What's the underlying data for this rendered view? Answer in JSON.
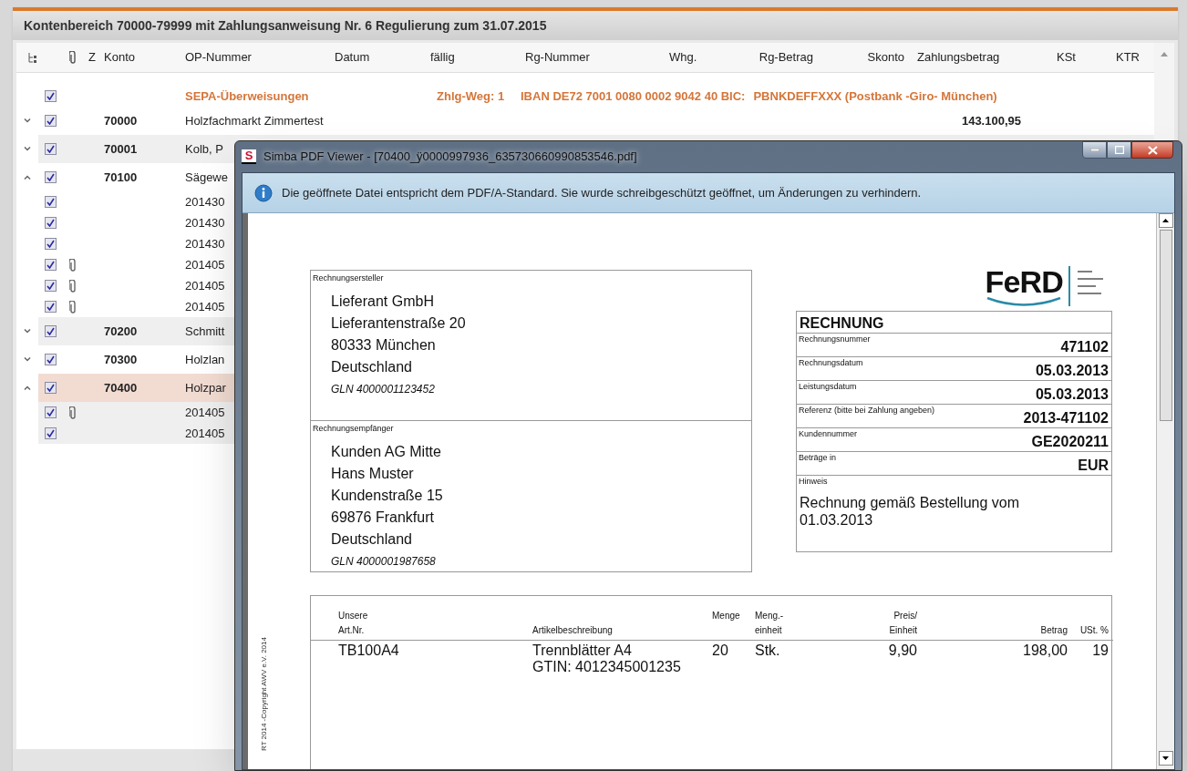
{
  "main_window": {
    "title": "Kontenbereich 70000-79999 mit Zahlungsanweisung Nr. 6 Regulierung zum 31.07.2015",
    "columns": [
      "Z",
      "Konto",
      "OP-Nummer",
      "Datum",
      "fällig",
      "Rg-Nummer",
      "Whg.",
      "Rg-Betrag",
      "Skonto",
      "Zahlungsbetrag",
      "KSt",
      "KTR"
    ],
    "rows": [
      {
        "kind": "payment_method",
        "checked": true,
        "name": "SEPA-Überweisungen",
        "route": "Zhlg-Weg: 1",
        "iban": "IBAN DE72 7001 0080 0002 9042 40 BIC:",
        "bic": "PBNKDEFFXXX (Postbank -Giro- München)"
      },
      {
        "kind": "account",
        "expanded": false,
        "checked": true,
        "selected": false,
        "shaded": false,
        "account": "70000",
        "name": "Holzfachmarkt Zimmertest",
        "amount": "143.100,95"
      },
      {
        "kind": "account",
        "expanded": false,
        "checked": true,
        "selected": false,
        "shaded": true,
        "account": "70001",
        "name": "Kolb, P"
      },
      {
        "kind": "account",
        "expanded": true,
        "checked": true,
        "selected": false,
        "shaded": false,
        "account": "70100",
        "name": "Sägewe"
      },
      {
        "kind": "item",
        "checked": true,
        "attachment": false,
        "shaded": false,
        "op_number": "201430"
      },
      {
        "kind": "item",
        "checked": true,
        "attachment": false,
        "shaded": false,
        "op_number": "201430"
      },
      {
        "kind": "item",
        "checked": true,
        "attachment": false,
        "shaded": false,
        "op_number": "201430"
      },
      {
        "kind": "item",
        "checked": true,
        "attachment": true,
        "shaded": false,
        "op_number": "201405"
      },
      {
        "kind": "item",
        "checked": true,
        "attachment": true,
        "shaded": false,
        "op_number": "201405"
      },
      {
        "kind": "item",
        "checked": true,
        "attachment": true,
        "shaded": false,
        "op_number": "201405"
      },
      {
        "kind": "account",
        "expanded": false,
        "checked": true,
        "selected": false,
        "shaded": true,
        "account": "70200",
        "name": "Schmitt"
      },
      {
        "kind": "account",
        "expanded": false,
        "checked": true,
        "selected": false,
        "shaded": false,
        "account": "70300",
        "name": "Holzlan"
      },
      {
        "kind": "account",
        "expanded": true,
        "checked": true,
        "selected": true,
        "account": "70400",
        "name": "Holzpar"
      },
      {
        "kind": "item",
        "checked": true,
        "attachment": true,
        "shaded": true,
        "op_number": "201405"
      },
      {
        "kind": "item",
        "checked": true,
        "attachment": false,
        "shaded": true,
        "op_number": "201405"
      }
    ]
  },
  "pdf_viewer": {
    "title": "Simba PDF Viewer - [70400_ÿ0000997936_635730660990853546.pdf]",
    "app_logo": "S",
    "info": "Die geöffnete Datei entspricht dem PDF/A-Standard. Sie wurde schreibgeschützt geöffnet, um Änderungen zu verhindern.",
    "document": {
      "sender": {
        "label": "Rechnungsersteller",
        "lines": [
          "Lieferant GmbH",
          "Lieferantenstraße 20",
          "80333 München",
          "Deutschland"
        ],
        "gln": "GLN 4000001123452"
      },
      "recipient": {
        "label": "Rechnungsempfänger",
        "lines": [
          "Kunden AG Mitte",
          "Hans Muster",
          "Kundenstraße 15",
          "69876 Frankfurt",
          "Deutschland"
        ],
        "gln": "GLN 4000001987658"
      },
      "logo": "FeRD",
      "invoice": {
        "title": "RECHNUNG",
        "fields": [
          {
            "label": "Rechnungsnummer",
            "value": "471102"
          },
          {
            "label": "Rechnungsdatum",
            "value": "05.03.2013"
          },
          {
            "label": "Leistungsdatum",
            "value": "05.03.2013"
          },
          {
            "label": "Referenz (bitte bei Zahlung angeben)",
            "value": "2013-471102"
          },
          {
            "label": "Kundennummer",
            "value": "GE2020211"
          },
          {
            "label": "Beträge in",
            "value": "EUR"
          }
        ],
        "note_label": "Hinweis",
        "note": "Rechnung gemäß Bestellung vom 01.03.2013"
      },
      "table": {
        "columns": [
          {
            "top": "Unsere",
            "bottom": "Art.Nr."
          },
          {
            "bottom": "Artikelbeschreibung"
          },
          {
            "top": "Menge"
          },
          {
            "top": "Meng.-",
            "bottom": "einheit"
          },
          {
            "top": "Preis/",
            "bottom": "Einheit"
          },
          {
            "bottom": "Betrag"
          },
          {
            "bottom": "USt. %"
          }
        ],
        "rows": [
          {
            "cells": [
              [
                "TB100A4"
              ],
              [
                "Trennblätter A4",
                "GTIN: 4012345001235"
              ],
              [
                "20"
              ],
              [
                "Stk."
              ],
              [
                "9,90"
              ],
              [
                "198,00"
              ],
              [
                "19"
              ]
            ]
          }
        ]
      },
      "copyright": "RT 2014 -Copyright AWV e.V. 2014"
    }
  }
}
